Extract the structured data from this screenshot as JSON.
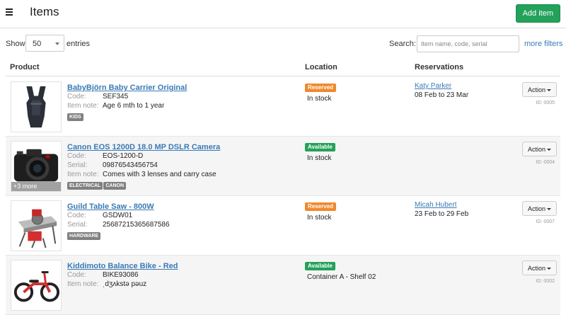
{
  "header": {
    "title": "Items",
    "add_label": "Add item"
  },
  "controls": {
    "show_label": "Show",
    "entries_value": "50",
    "entries_label": "entries",
    "search_label": "Search:",
    "search_placeholder": "Item name, code, serial",
    "more_filters": "more filters"
  },
  "columns": {
    "product": "Product",
    "location": "Location",
    "reservations": "Reservations"
  },
  "field_labels": {
    "code": "Code:",
    "serial": "Serial:",
    "note": "Item note:"
  },
  "rows": [
    {
      "name": "BabyBjörn Baby Carrier Original",
      "code": "SEF345",
      "note": "Age 6 mth to 1 year",
      "tags": [
        "KIDS"
      ],
      "status": "Reserved",
      "location": "In stock",
      "res_name": "Katy Parker",
      "res_dates": "08 Feb to 23 Mar",
      "action": "Action",
      "id": "ID: 0005"
    },
    {
      "name": "Canon EOS 1200D 18.0 MP DSLR Camera",
      "code": "EOS-1200-D",
      "serial": "09876543456754",
      "note": "Comes with 3 lenses and carry case",
      "tags": [
        "ELECTRICAL",
        "CANON"
      ],
      "more": "+3 more",
      "status": "Available",
      "location": "In stock",
      "action": "Action",
      "id": "ID: 0004"
    },
    {
      "name": "Guild Table Saw - 800W",
      "code": "GSDW01",
      "serial": "25687215365687586",
      "tags": [
        "HARDWARE"
      ],
      "status": "Reserved",
      "location": "In stock",
      "res_name": "Micah Hubert",
      "res_dates": "23 Feb to 29 Feb",
      "action": "Action",
      "id": "ID: 0007"
    },
    {
      "name": "Kiddimoto Balance Bike - Red",
      "code": "BIKE93086",
      "note": "ˌdʒʌkstə pəuz",
      "status": "Available",
      "location": "Container A - Shelf 02",
      "action": "Action",
      "id": "ID: 0002"
    }
  ],
  "colors": {
    "accent_green": "#24a15a",
    "reserved_orange": "#f0892d",
    "link_blue": "#3a7ab5",
    "tag_gray": "#808080"
  },
  "icons": {
    "menu": "hamburger-icon",
    "dropdown": "caret-down-icon"
  }
}
